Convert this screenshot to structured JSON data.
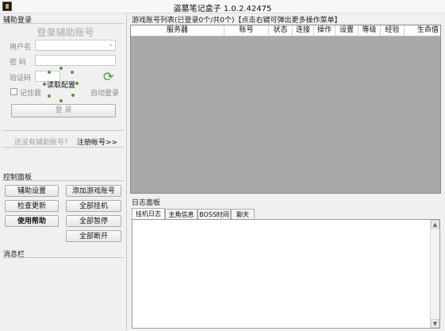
{
  "window": {
    "title": "盗墓笔记盒子 1.0.2.42475"
  },
  "login": {
    "group_title": "辅助登录",
    "heading": "登录辅助账号",
    "username_label": "用户名",
    "password_label": "密  码",
    "captcha_label": "验证码",
    "remember_label": "记住我",
    "auto_login_label": "自动登录",
    "loading_text": "读取配置",
    "login_button": "登 录",
    "no_account_text": "还没有辅助账号?",
    "register_link": "注册帐号>>",
    "username_value": "",
    "password_value": "",
    "captcha_value": ""
  },
  "control": {
    "group_title": "控制面板",
    "buttons": {
      "assist_settings": "辅助设置",
      "add_game_account": "添加游戏账号",
      "check_update": "检查更新",
      "hang_all": "全部挂机",
      "usage_help": "使用帮助",
      "pause_all": "全部暂停",
      "disconnect_all": "全部断开"
    }
  },
  "message": {
    "group_title": "消息栏"
  },
  "accounts": {
    "group_title": "游戏账号列表(已登录0个/共0个)【点击右键可弹出更多操作菜单】",
    "columns": [
      "服务器",
      "账号",
      "状态",
      "连接",
      "操作",
      "设置",
      "等级",
      "经验",
      "生命值"
    ]
  },
  "log": {
    "group_title": "日志面板",
    "tabs": [
      "挂机日志",
      "主角信息",
      "BOSS时间",
      "聊天"
    ],
    "active_tab": 0
  },
  "colors": {
    "table_bg": "#a9a9a9",
    "spinner": "#4c9b2a",
    "refresh_icon": "#3aa034"
  }
}
